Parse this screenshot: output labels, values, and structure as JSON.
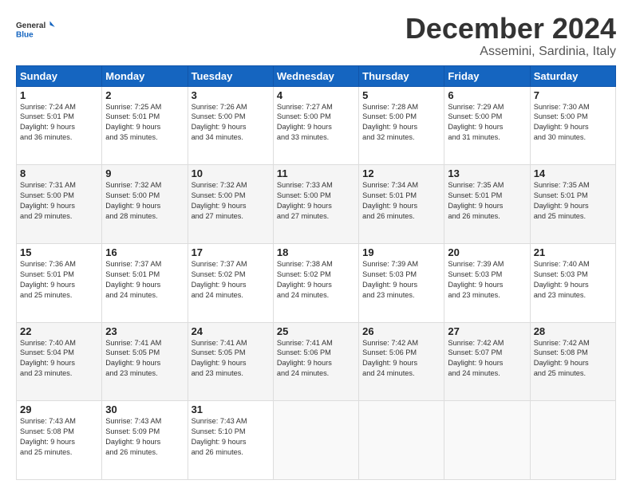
{
  "header": {
    "logo_line1": "General",
    "logo_line2": "Blue",
    "title": "December 2024",
    "subtitle": "Assemini, Sardinia, Italy"
  },
  "weekdays": [
    "Sunday",
    "Monday",
    "Tuesday",
    "Wednesday",
    "Thursday",
    "Friday",
    "Saturday"
  ],
  "weeks": [
    [
      {
        "day": "1",
        "info": "Sunrise: 7:24 AM\nSunset: 5:01 PM\nDaylight: 9 hours\nand 36 minutes."
      },
      {
        "day": "2",
        "info": "Sunrise: 7:25 AM\nSunset: 5:01 PM\nDaylight: 9 hours\nand 35 minutes."
      },
      {
        "day": "3",
        "info": "Sunrise: 7:26 AM\nSunset: 5:00 PM\nDaylight: 9 hours\nand 34 minutes."
      },
      {
        "day": "4",
        "info": "Sunrise: 7:27 AM\nSunset: 5:00 PM\nDaylight: 9 hours\nand 33 minutes."
      },
      {
        "day": "5",
        "info": "Sunrise: 7:28 AM\nSunset: 5:00 PM\nDaylight: 9 hours\nand 32 minutes."
      },
      {
        "day": "6",
        "info": "Sunrise: 7:29 AM\nSunset: 5:00 PM\nDaylight: 9 hours\nand 31 minutes."
      },
      {
        "day": "7",
        "info": "Sunrise: 7:30 AM\nSunset: 5:00 PM\nDaylight: 9 hours\nand 30 minutes."
      }
    ],
    [
      {
        "day": "8",
        "info": "Sunrise: 7:31 AM\nSunset: 5:00 PM\nDaylight: 9 hours\nand 29 minutes."
      },
      {
        "day": "9",
        "info": "Sunrise: 7:32 AM\nSunset: 5:00 PM\nDaylight: 9 hours\nand 28 minutes."
      },
      {
        "day": "10",
        "info": "Sunrise: 7:32 AM\nSunset: 5:00 PM\nDaylight: 9 hours\nand 27 minutes."
      },
      {
        "day": "11",
        "info": "Sunrise: 7:33 AM\nSunset: 5:00 PM\nDaylight: 9 hours\nand 27 minutes."
      },
      {
        "day": "12",
        "info": "Sunrise: 7:34 AM\nSunset: 5:01 PM\nDaylight: 9 hours\nand 26 minutes."
      },
      {
        "day": "13",
        "info": "Sunrise: 7:35 AM\nSunset: 5:01 PM\nDaylight: 9 hours\nand 26 minutes."
      },
      {
        "day": "14",
        "info": "Sunrise: 7:35 AM\nSunset: 5:01 PM\nDaylight: 9 hours\nand 25 minutes."
      }
    ],
    [
      {
        "day": "15",
        "info": "Sunrise: 7:36 AM\nSunset: 5:01 PM\nDaylight: 9 hours\nand 25 minutes."
      },
      {
        "day": "16",
        "info": "Sunrise: 7:37 AM\nSunset: 5:01 PM\nDaylight: 9 hours\nand 24 minutes."
      },
      {
        "day": "17",
        "info": "Sunrise: 7:37 AM\nSunset: 5:02 PM\nDaylight: 9 hours\nand 24 minutes."
      },
      {
        "day": "18",
        "info": "Sunrise: 7:38 AM\nSunset: 5:02 PM\nDaylight: 9 hours\nand 24 minutes."
      },
      {
        "day": "19",
        "info": "Sunrise: 7:39 AM\nSunset: 5:03 PM\nDaylight: 9 hours\nand 23 minutes."
      },
      {
        "day": "20",
        "info": "Sunrise: 7:39 AM\nSunset: 5:03 PM\nDaylight: 9 hours\nand 23 minutes."
      },
      {
        "day": "21",
        "info": "Sunrise: 7:40 AM\nSunset: 5:03 PM\nDaylight: 9 hours\nand 23 minutes."
      }
    ],
    [
      {
        "day": "22",
        "info": "Sunrise: 7:40 AM\nSunset: 5:04 PM\nDaylight: 9 hours\nand 23 minutes."
      },
      {
        "day": "23",
        "info": "Sunrise: 7:41 AM\nSunset: 5:05 PM\nDaylight: 9 hours\nand 23 minutes."
      },
      {
        "day": "24",
        "info": "Sunrise: 7:41 AM\nSunset: 5:05 PM\nDaylight: 9 hours\nand 23 minutes."
      },
      {
        "day": "25",
        "info": "Sunrise: 7:41 AM\nSunset: 5:06 PM\nDaylight: 9 hours\nand 24 minutes."
      },
      {
        "day": "26",
        "info": "Sunrise: 7:42 AM\nSunset: 5:06 PM\nDaylight: 9 hours\nand 24 minutes."
      },
      {
        "day": "27",
        "info": "Sunrise: 7:42 AM\nSunset: 5:07 PM\nDaylight: 9 hours\nand 24 minutes."
      },
      {
        "day": "28",
        "info": "Sunrise: 7:42 AM\nSunset: 5:08 PM\nDaylight: 9 hours\nand 25 minutes."
      }
    ],
    [
      {
        "day": "29",
        "info": "Sunrise: 7:43 AM\nSunset: 5:08 PM\nDaylight: 9 hours\nand 25 minutes."
      },
      {
        "day": "30",
        "info": "Sunrise: 7:43 AM\nSunset: 5:09 PM\nDaylight: 9 hours\nand 26 minutes."
      },
      {
        "day": "31",
        "info": "Sunrise: 7:43 AM\nSunset: 5:10 PM\nDaylight: 9 hours\nand 26 minutes."
      },
      null,
      null,
      null,
      null
    ]
  ]
}
